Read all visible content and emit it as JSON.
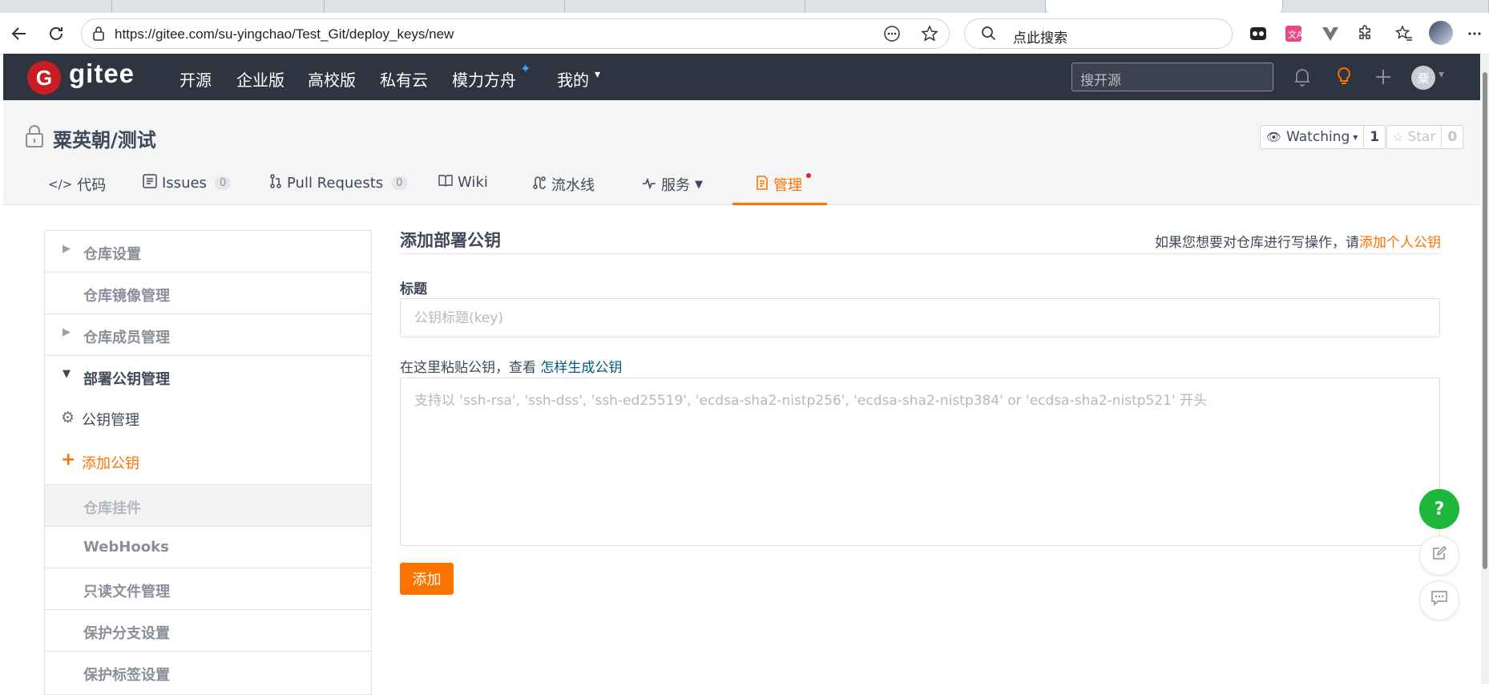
{
  "browser": {
    "url": "https://gitee.com/su-yingchao/Test_Git/deploy_keys/new",
    "search_placeholder": "点此搜索"
  },
  "header": {
    "logo_text": "gitee",
    "logo_letter": "G",
    "nav": [
      "开源",
      "企业版",
      "高校版",
      "私有云",
      "模力方舟",
      "我的"
    ],
    "search_placeholder": "搜开源",
    "avatar_letter": "粟"
  },
  "repo": {
    "title": "粟英朝/测试",
    "watching_label": "Watching",
    "watching_count": "1",
    "star_label": "Star",
    "star_count": "0",
    "tabs": {
      "code": "代码",
      "issues": "Issues",
      "issues_count": "0",
      "pulls": "Pull Requests",
      "pulls_count": "0",
      "wiki": "Wiki",
      "pipeline": "流水线",
      "service": "服务",
      "manage": "管理"
    }
  },
  "sidebar": {
    "repo_settings": "仓库设置",
    "mirror": "仓库镜像管理",
    "members": "仓库成员管理",
    "deploy_keys": "部署公钥管理",
    "key_manage": "公钥管理",
    "add_key": "添加公钥",
    "plugins": "仓库挂件",
    "webhooks": "WebHooks",
    "readonly": "只读文件管理",
    "protect_branch": "保护分支设置",
    "protect_tag": "保护标签设置"
  },
  "form": {
    "title": "添加部署公钥",
    "hint_prefix": "如果您想要对仓库进行写操作，请",
    "hint_link": "添加个人公钥",
    "label_title": "标题",
    "title_placeholder": "公钥标题(key)",
    "label_key_prefix": "在这里粘贴公钥，查看",
    "label_key_link": "怎样生成公钥",
    "key_placeholder": "支持以 'ssh-rsa', 'ssh-dss', 'ssh-ed25519', 'ecdsa-sha2-nistp256', 'ecdsa-sha2-nistp384' or 'ecdsa-sha2-nistp521' 开头",
    "submit": "添加"
  },
  "float": {
    "help": "?"
  },
  "colors": {
    "brand": "#c71d23",
    "accent": "#fe7300",
    "header_bg": "#2e3440",
    "help_green": "#1db53a"
  }
}
